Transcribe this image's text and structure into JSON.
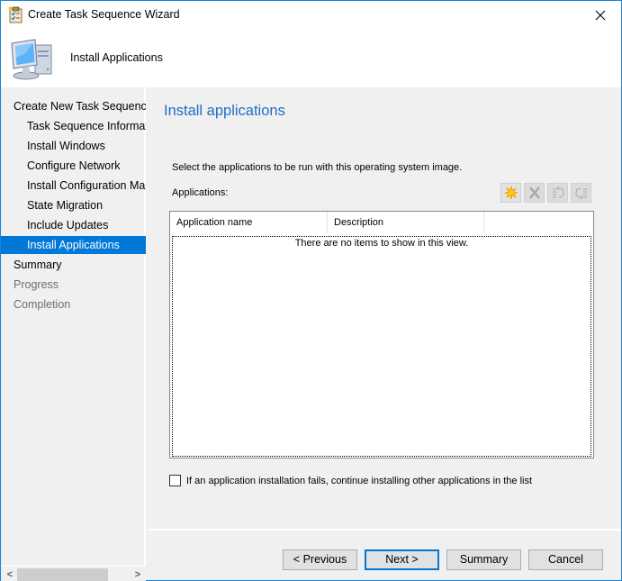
{
  "window": {
    "title": "Create Task Sequence Wizard",
    "icon": "checklist-icon",
    "close_icon": "close-icon",
    "accent_color": "#1883d7"
  },
  "header": {
    "title": "Install Applications",
    "icon": "computer-icon"
  },
  "sidebar": {
    "items": [
      {
        "label": "Create New Task Sequence",
        "level": 0,
        "state": "normal"
      },
      {
        "label": "Task Sequence Information",
        "level": 1,
        "state": "normal"
      },
      {
        "label": "Install Windows",
        "level": 1,
        "state": "normal"
      },
      {
        "label": "Configure Network",
        "level": 1,
        "state": "normal"
      },
      {
        "label": "Install Configuration Manager",
        "level": 1,
        "state": "normal"
      },
      {
        "label": "State Migration",
        "level": 1,
        "state": "normal"
      },
      {
        "label": "Include Updates",
        "level": 1,
        "state": "normal"
      },
      {
        "label": "Install Applications",
        "level": 1,
        "state": "active"
      },
      {
        "label": "Summary",
        "level": 0,
        "state": "normal"
      },
      {
        "label": "Progress",
        "level": 0,
        "state": "disabled"
      },
      {
        "label": "Completion",
        "level": 0,
        "state": "disabled"
      }
    ],
    "scroll_left": "<",
    "scroll_right": ">",
    "active_color": "#0078d7"
  },
  "content": {
    "title": "Install applications",
    "title_color": "#1e6fc5",
    "instruction": "Select the applications to be run with this operating system image.",
    "applications_label": "Applications:",
    "toolbar": [
      {
        "name": "new-icon",
        "enabled": true
      },
      {
        "name": "delete-icon",
        "enabled": false
      },
      {
        "name": "move-up-icon",
        "enabled": false
      },
      {
        "name": "move-down-icon",
        "enabled": false
      }
    ],
    "list": {
      "columns": [
        "Application name",
        "Description",
        ""
      ],
      "empty_text": "There are no items to show in this view.",
      "rows": []
    },
    "continue_on_fail": {
      "label": "If an application installation fails, continue installing other applications in the list",
      "checked": false
    }
  },
  "footer": {
    "previous": "< Previous",
    "next": "Next >",
    "summary": "Summary",
    "cancel": "Cancel"
  }
}
